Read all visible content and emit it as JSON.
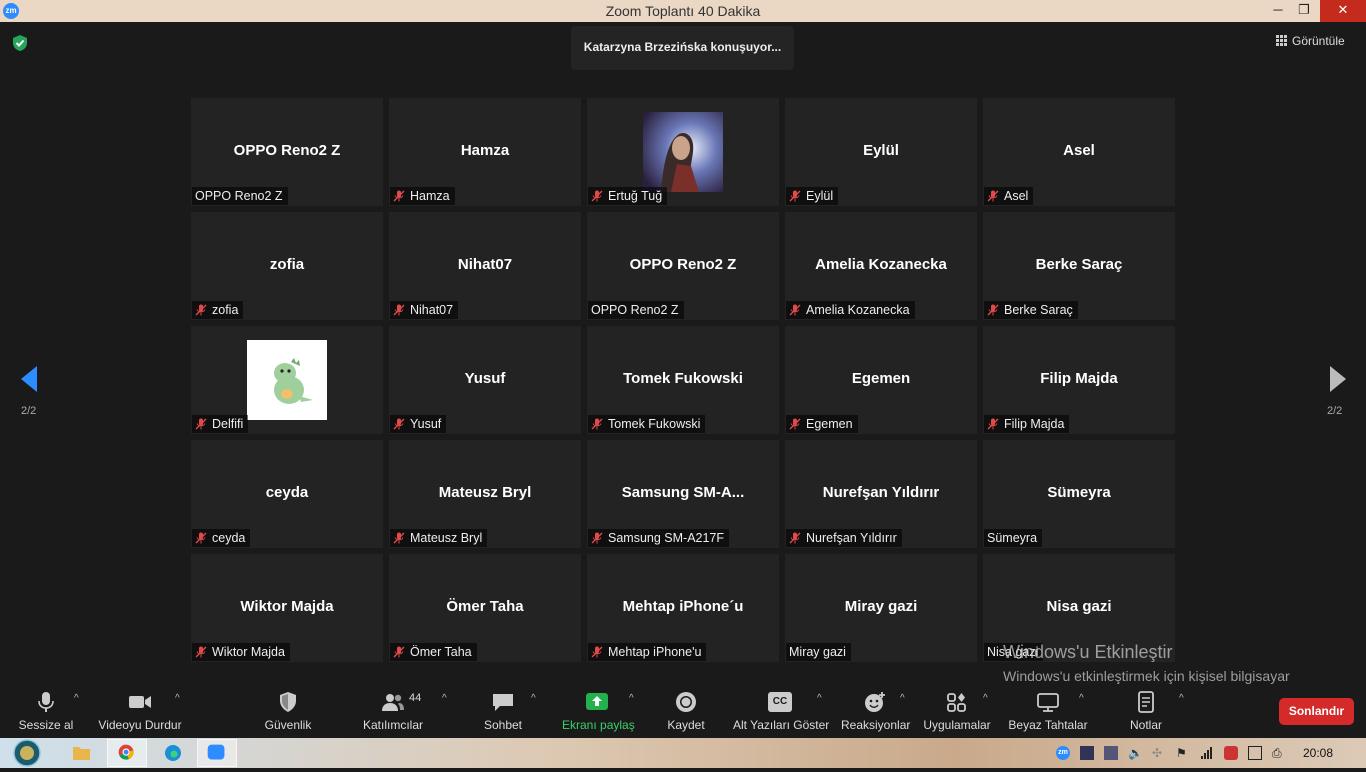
{
  "window": {
    "title": "Zoom Toplantı 40 Dakika",
    "app_icon_text": "zm"
  },
  "speaking_banner": "Katarzyna Brzezińska konuşuyor...",
  "view_button": "Görüntüle",
  "page": {
    "label": "2/2"
  },
  "participants": [
    {
      "name": "OPPO Reno2 Z",
      "label": "OPPO Reno2 Z",
      "muted": false
    },
    {
      "name": "Hamza",
      "label": "Hamza",
      "muted": true
    },
    {
      "name": "",
      "label": "Ertuğ Tuğ",
      "muted": true,
      "avatar": "portrait-photo"
    },
    {
      "name": "Eylül",
      "label": "Eylül",
      "muted": true
    },
    {
      "name": "Asel",
      "label": "Asel",
      "muted": true
    },
    {
      "name": "zofia",
      "label": "zofia",
      "muted": true
    },
    {
      "name": "Nihat07",
      "label": "Nihat07",
      "muted": true
    },
    {
      "name": "OPPO Reno2 Z",
      "label": "OPPO Reno2 Z",
      "muted": false
    },
    {
      "name": "Amelia Kozanecka",
      "label": "Amelia Kozanecka",
      "muted": true
    },
    {
      "name": "Berke Saraç",
      "label": "Berke Saraç",
      "muted": true
    },
    {
      "name": "",
      "label": "Delfifi",
      "muted": true,
      "avatar": "dinosaur-sticker"
    },
    {
      "name": "Yusuf",
      "label": "Yusuf",
      "muted": true
    },
    {
      "name": "Tomek Fukowski",
      "label": "Tomek Fukowski",
      "muted": true
    },
    {
      "name": "Egemen",
      "label": "Egemen",
      "muted": true
    },
    {
      "name": "Filip Majda",
      "label": "Filip Majda",
      "muted": true
    },
    {
      "name": "ceyda",
      "label": "ceyda",
      "muted": true
    },
    {
      "name": "Mateusz Bryl",
      "label": "Mateusz Bryl",
      "muted": true
    },
    {
      "name": "Samsung  SM-A...",
      "label": "Samsung SM-A217F",
      "muted": true
    },
    {
      "name": "Nurefşan Yıldırır",
      "label": "Nurefşan Yıldırır",
      "muted": true
    },
    {
      "name": "Sümeyra",
      "label": "Sümeyra",
      "muted": false
    },
    {
      "name": "Wiktor Majda",
      "label": "Wiktor Majda",
      "muted": true
    },
    {
      "name": "Ömer Taha",
      "label": "Ömer Taha",
      "muted": true
    },
    {
      "name": "Mehtap iPhone´u",
      "label": "Mehtap iPhone'u",
      "muted": true
    },
    {
      "name": "Miray gazi",
      "label": "Miray gazi",
      "muted": false
    },
    {
      "name": "Nisa gazi",
      "label": "Nisa gazi",
      "muted": false
    }
  ],
  "watermark": {
    "title": "Windows'u Etkinleştir",
    "text": "Windows'u etkinleştirmek için kişisel bilgisayar ayarlarına gidin."
  },
  "toolbar": {
    "mute": "Sessize al",
    "video": "Videoyu Durdur",
    "security": "Güvenlik",
    "participants": "Katılımcılar",
    "participants_count": "44",
    "chat": "Sohbet",
    "share": "Ekranı paylaş",
    "record": "Kaydet",
    "captions": "Alt Yazıları Göster",
    "captions_icon_text": "CC",
    "reactions": "Reaksiyonlar",
    "apps": "Uygulamalar",
    "whiteboards": "Beyaz Tahtalar",
    "notes": "Notlar",
    "end": "Sonlandır",
    "share_color": "#3ad06a",
    "end_color": "#d42a2a"
  },
  "taskbar": {
    "clock": "20:08",
    "zoom_tray_text": "zm"
  },
  "icons": [
    "shield-check-icon",
    "grid-icon",
    "mute-mic-icon",
    "microphone-icon",
    "video-camera-icon",
    "shield-icon",
    "participants-icon",
    "chat-bubble-icon",
    "share-screen-icon",
    "record-icon",
    "closed-captions-icon",
    "reactions-icon",
    "apps-icon",
    "whiteboard-icon",
    "notes-icon",
    "left-arrow-icon",
    "right-arrow-icon"
  ]
}
